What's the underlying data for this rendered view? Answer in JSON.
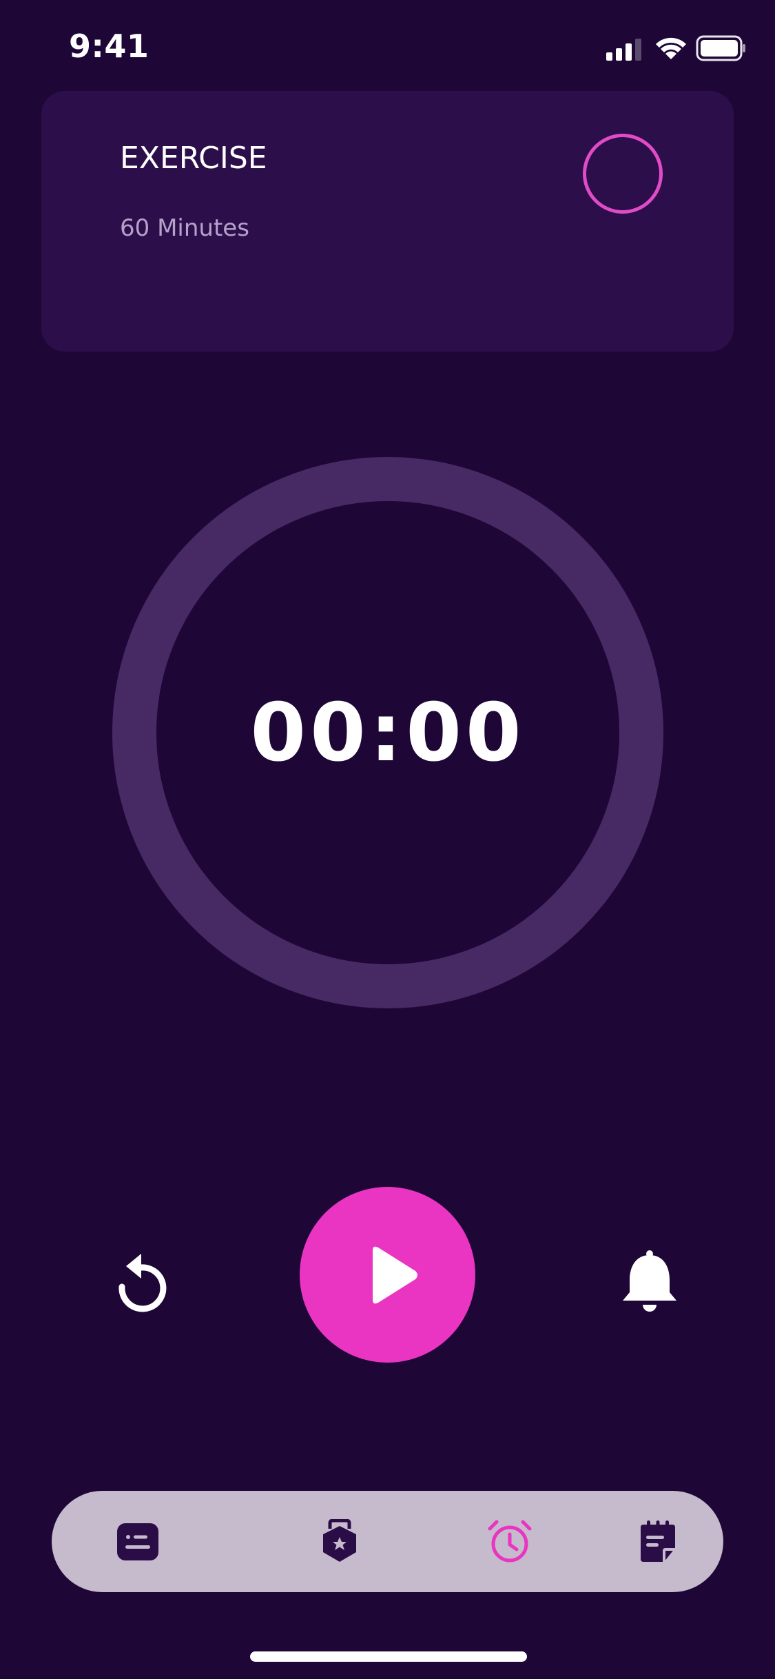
{
  "status_bar": {
    "time": "9:41",
    "icons": [
      "cellular-signal-icon",
      "wifi-icon",
      "battery-icon"
    ]
  },
  "task": {
    "title": "EXERCISE",
    "duration": "60 Minutes"
  },
  "timer": {
    "display": "00:00",
    "progress": 0
  },
  "controls": {
    "reset_icon": "reset-icon",
    "play_icon": "play-icon",
    "bell_icon": "bell-icon"
  },
  "tab_bar": {
    "active_tab": "timer",
    "tabs": [
      {
        "id": "tasks",
        "icon": "tasks-icon"
      },
      {
        "id": "badges",
        "icon": "badge-icon"
      },
      {
        "id": "timer",
        "icon": "alarm-clock-icon"
      },
      {
        "id": "notes",
        "icon": "notepad-icon"
      }
    ]
  },
  "colors": {
    "background": "#1e0637",
    "card": "#2c0f4a",
    "accent": "#e935c1",
    "ring": "#472964",
    "tab_bar": "#c6bacd",
    "tab_icon": "#2a0d46",
    "muted_text": "#b5a1cc"
  }
}
